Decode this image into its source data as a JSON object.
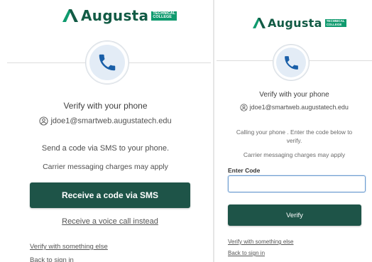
{
  "brand": {
    "name": "Augusta",
    "tag_line1": "TECHNICAL",
    "tag_line2": "COLLEGE",
    "color": "#125b45",
    "accent": "#0f9a6e"
  },
  "left": {
    "title": "Verify with your phone",
    "email": "jdoe1@smartweb.augustatech.edu",
    "instruction": "Send a code via SMS to your phone.",
    "charges": "Carrier messaging charges may apply",
    "primary_button": "Receive a code via SMS",
    "voice_link": "Receive a voice call instead",
    "verify_else": "Verify with something else",
    "back": "Back to sign in"
  },
  "right": {
    "title": "Verify with your phone",
    "email": "jdoe1@smartweb.augustatech.edu",
    "instruction_line1": "Calling your phone .  Enter the code below to",
    "instruction_line2": "verify.",
    "charges": "Carrier messaging charges may apply",
    "field_label": "Enter Code",
    "field_value": "",
    "primary_button": "Verify",
    "verify_else": "Verify with something else",
    "back": "Back to sign in"
  },
  "icons": {
    "phone": "phone-icon",
    "user": "user-circle-icon",
    "logo": "augusta-logo-mark"
  },
  "colors": {
    "button": "#1e5448",
    "phone_icon": "#1a5fa8",
    "input_border": "#6f9ed1"
  }
}
